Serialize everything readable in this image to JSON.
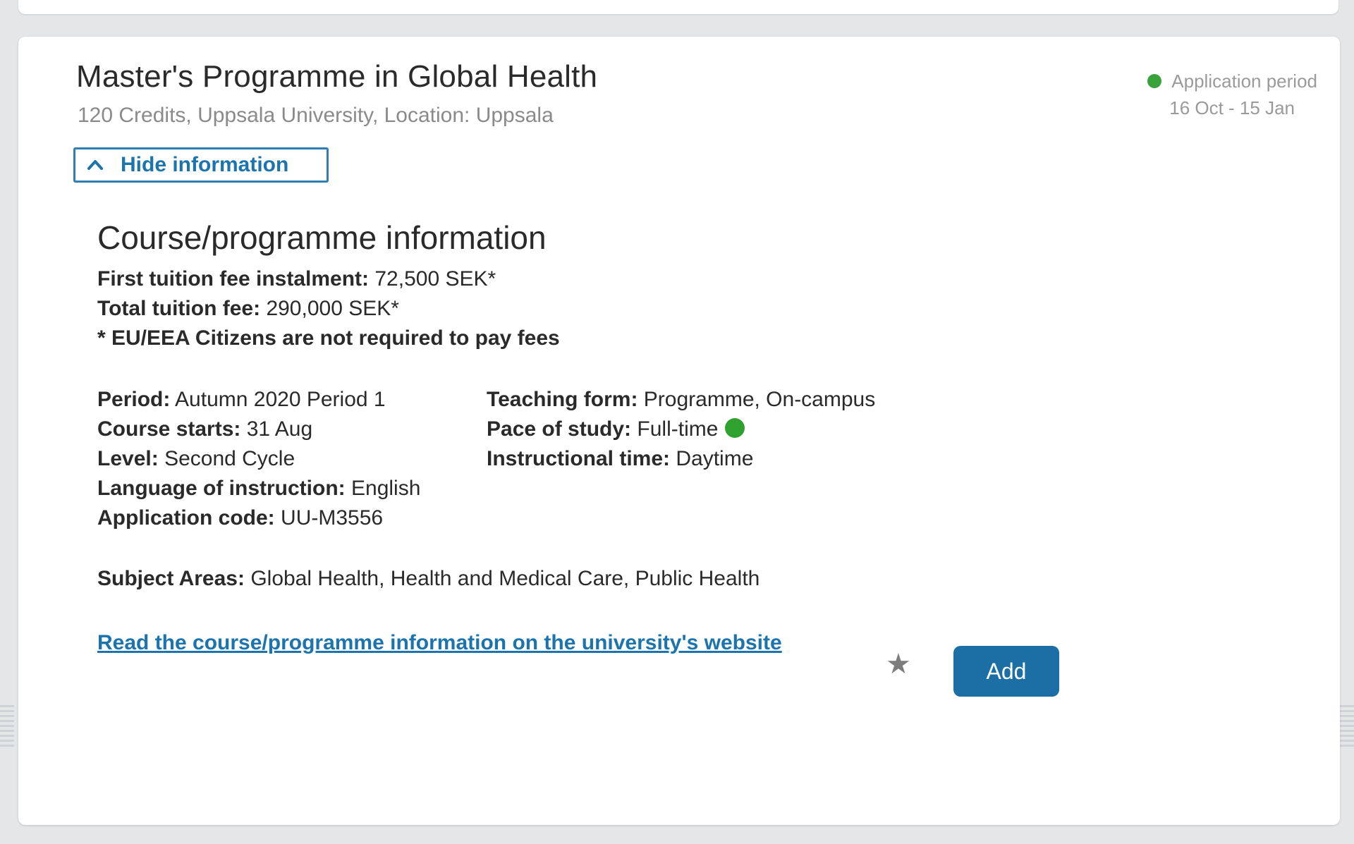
{
  "programme": {
    "title": "Master's Programme in Global Health",
    "subtitle": "120 Credits, Uppsala University, Location:  Uppsala"
  },
  "application_status": {
    "label": "Application period",
    "dates": "16 Oct - 15 Jan",
    "status_color": "#3aa23a"
  },
  "toggle": {
    "label": "Hide information",
    "icon": "chevron-up-icon"
  },
  "info": {
    "heading": "Course/programme information",
    "first_fee_label": "First tuition fee instalment:",
    "first_fee_value": "72,500 SEK*",
    "total_fee_label": "Total tuition fee:",
    "total_fee_value": "290,000 SEK*",
    "fee_note": "* EU/EEA Citizens are not required to pay fees",
    "left_details": [
      {
        "label": "Period:",
        "value": "Autumn 2020 Period 1"
      },
      {
        "label": "Course starts:",
        "value": "31 Aug"
      },
      {
        "label": "Level:",
        "value": "Second Cycle"
      },
      {
        "label": "Language of instruction:",
        "value": "English"
      },
      {
        "label": "Application code:",
        "value": "UU-M3556"
      }
    ],
    "right_details": [
      {
        "label": "Teaching form:",
        "value": "Programme, On-campus"
      },
      {
        "label": "Pace of study:",
        "value": "Full-time"
      },
      {
        "label": "Instructional time:",
        "value": "Daytime"
      }
    ],
    "subjects_label": "Subject Areas:",
    "subjects_value": "Global Health, Health and Medical Care, Public Health",
    "website_link": "Read the course/programme information on the university's website"
  },
  "actions": {
    "favorite_icon": "star-icon",
    "add_label": "Add",
    "accent_color": "#1c6fa5"
  }
}
